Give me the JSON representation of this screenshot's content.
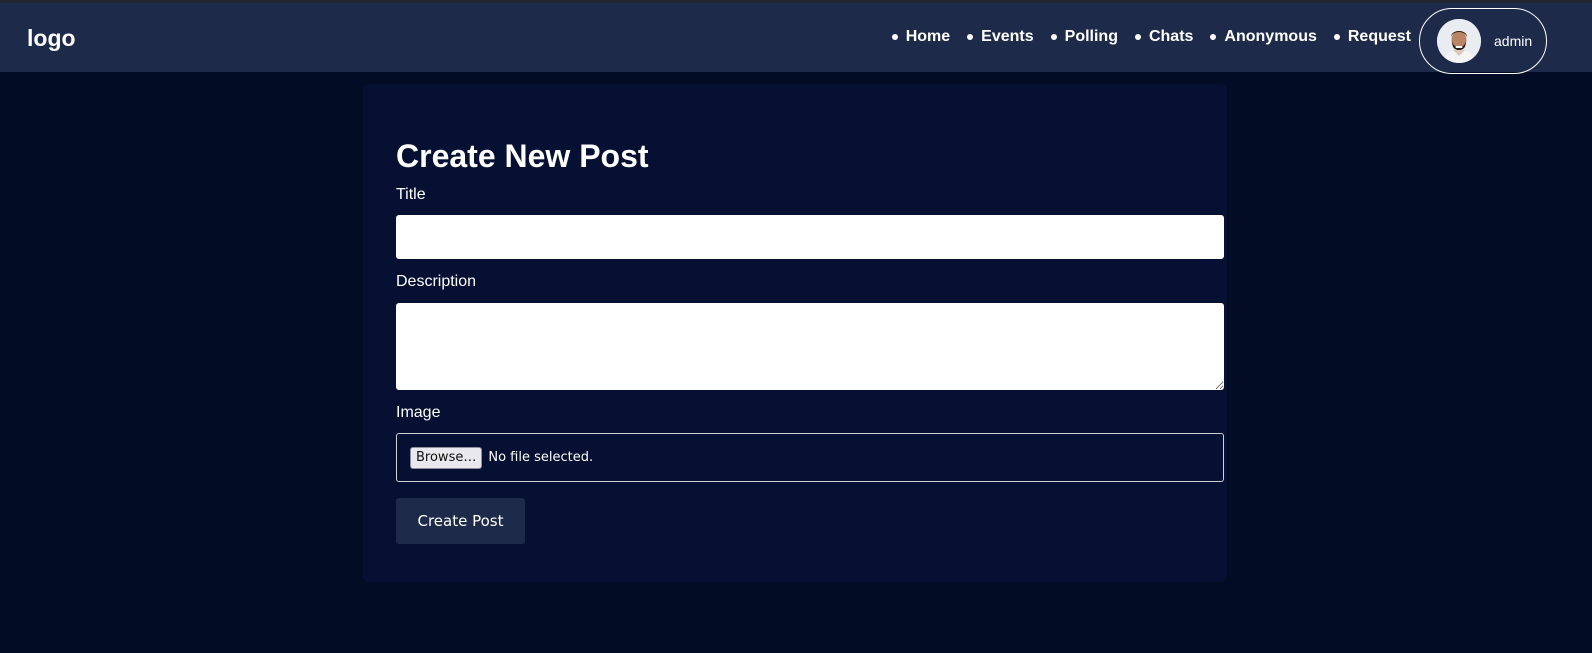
{
  "header": {
    "logo": "logo",
    "nav": [
      {
        "label": "Home"
      },
      {
        "label": "Events"
      },
      {
        "label": "Polling"
      },
      {
        "label": "Chats"
      },
      {
        "label": "Anonymous"
      },
      {
        "label": "Request"
      }
    ],
    "profile": {
      "name": "admin",
      "avatar_icon": "user-avatar"
    }
  },
  "form": {
    "heading": "Create New Post",
    "title_label": "Title",
    "title_value": "",
    "description_label": "Description",
    "description_value": "",
    "image_label": "Image",
    "browse_label": "Browse…",
    "file_status": "No file selected.",
    "submit_label": "Create Post"
  },
  "colors": {
    "page_background": "#030c25",
    "navbar": "#1d2a4a",
    "card": "#061032",
    "button": "#1d2a4a",
    "text": "#ffffff"
  }
}
